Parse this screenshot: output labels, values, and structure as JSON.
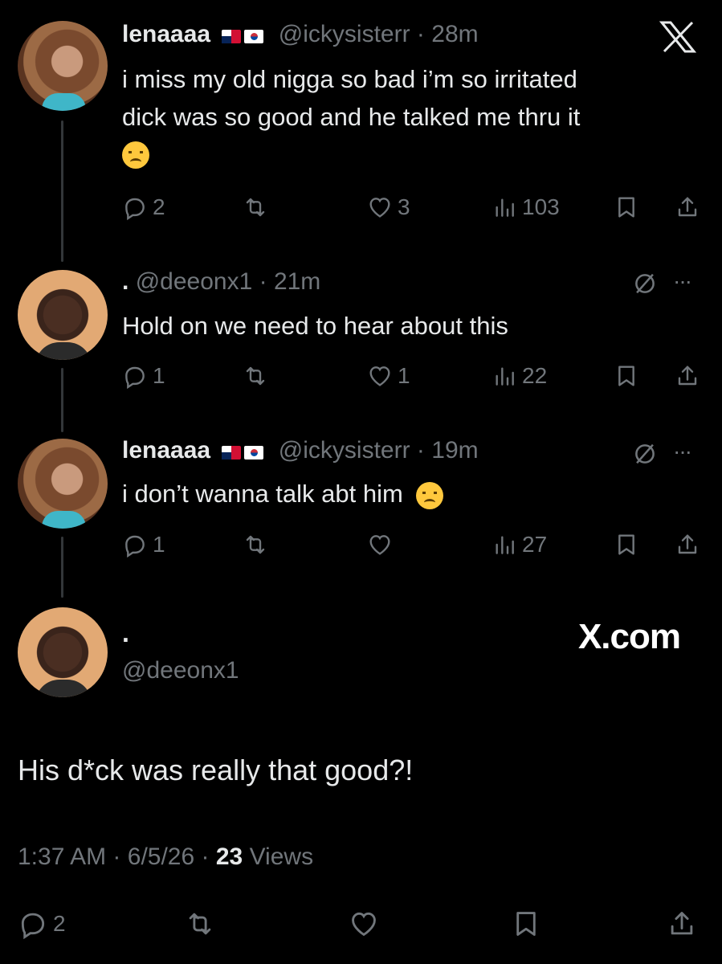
{
  "tweet1": {
    "name": "lenaaaa",
    "handle": "@ickysisterr",
    "sep": "·",
    "time": "28m",
    "text_line1": "i miss my old nigga so bad i’m so irritated",
    "text_line2": "dick was so good and he talked me thru it",
    "replies": "2",
    "likes": "3",
    "views": "103"
  },
  "tweet2": {
    "name": ".",
    "handle": "@deeonx1",
    "sep": "·",
    "time": "21m",
    "text": "Hold on we need to hear about this",
    "replies": "1",
    "likes": "1",
    "views": "22"
  },
  "tweet3": {
    "name": "lenaaaa",
    "handle": "@ickysisterr",
    "sep": "·",
    "time": "19m",
    "text": "i don’t wanna talk abt him",
    "replies": "1",
    "views": "27"
  },
  "main": {
    "name": ".",
    "handle": "@deeonx1",
    "watermark": "X.com",
    "text": "His d*ck was really that good?!",
    "time": "1:37 AM",
    "sep": "·",
    "date": "6/5/26",
    "views_count": "23",
    "views_label": "Views",
    "replies": "2"
  },
  "icons": [
    "x-logo-icon",
    "reply-icon",
    "retweet-icon",
    "like-icon",
    "views-icon",
    "bookmark-icon",
    "share-icon",
    "grok-icon",
    "more-icon"
  ],
  "colors": {
    "background": "#000000",
    "text": "#e7e9ea",
    "muted": "#71767b"
  }
}
